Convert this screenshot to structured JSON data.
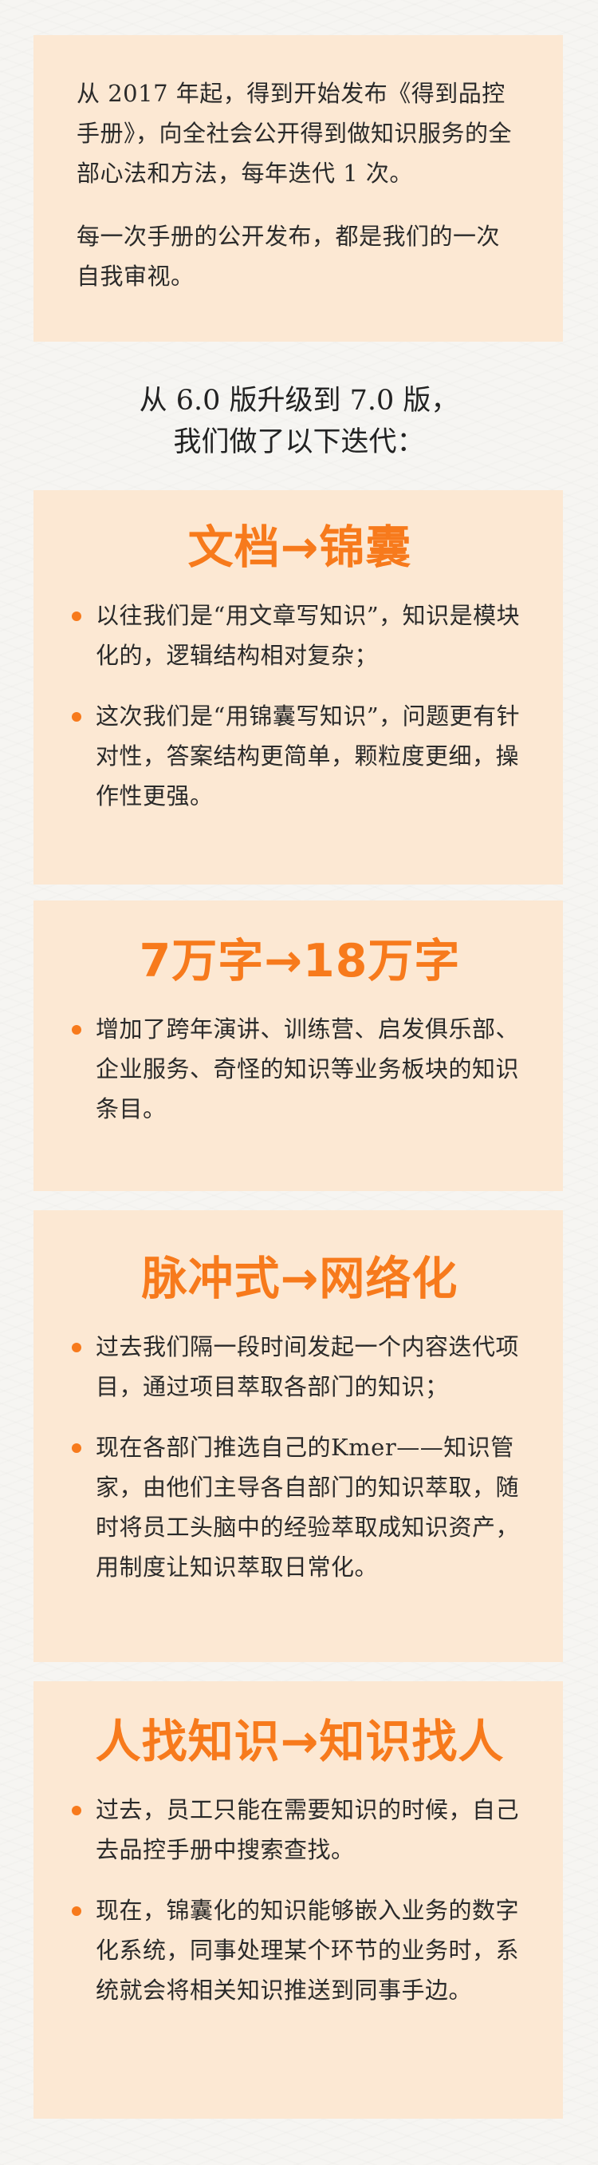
{
  "intro": {
    "paragraphs": [
      "从 2017 年起，得到开始发布《得到品控手册》，向全社会公开得到做知识服务的全部心法和方法，每年迭代 1 次。",
      "每一次手册的公开发布，都是我们的一次自我审视。"
    ]
  },
  "iteration_heading": {
    "line1": "从 6.0 版升级到 7.0 版，",
    "line2": "我们做了以下迭代："
  },
  "topics": [
    {
      "title": "文档→锦囊",
      "bullets": [
        "以往我们是“用文章写知识”，知识是模块化的，逻辑结构相对复杂；",
        "这次我们是“用锦囊写知识”，问题更有针对性，答案结构更简单，颗粒度更细，操作性更强。"
      ]
    },
    {
      "title": "7万字→18万字",
      "bullets": [
        "增加了跨年演讲、训练营、启发俱乐部、企业服务、奇怪的知识等业务板块的知识条目。"
      ]
    },
    {
      "title": "脉冲式→网络化",
      "bullets": [
        "过去我们隔一段时间发起一个内容迭代项目，通过项目萃取各部门的知识；",
        "现在各部门推选自己的Kmer——知识管家，由他们主导各自部门的知识萃取，随时将员工头脑中的经验萃取成知识资产，用制度让知识萃取日常化。"
      ]
    },
    {
      "title": "人找知识→知识找人",
      "bullets": [
        "过去，员工只能在需要知识的时候，自己去品控手册中搜索查找。",
        "现在，锦囊化的知识能够嵌入业务的数字化系统，同事处理某个环节的业务时，系统就会将相关知识推送到同事手边。"
      ]
    }
  ],
  "colors": {
    "accent": "#f77a1c",
    "card_background": "#fce8d3",
    "page_background": "#f6f5f2",
    "text": "#2a2a2a"
  }
}
